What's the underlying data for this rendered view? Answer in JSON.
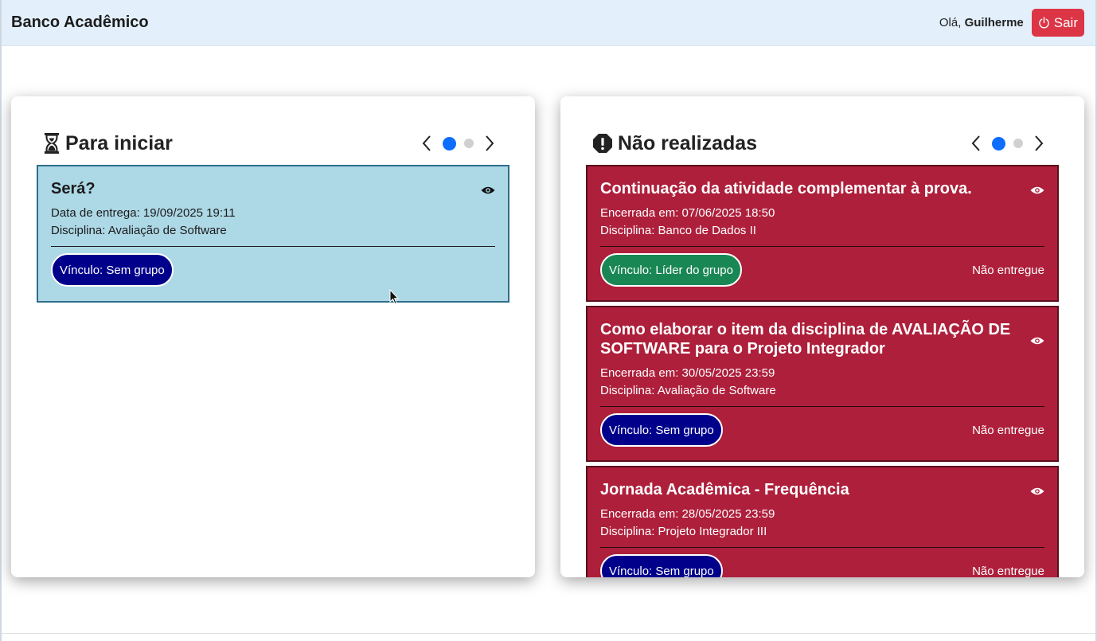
{
  "header": {
    "brand": "Banco Acadêmico",
    "greeting_prefix": "Olá, ",
    "user_name": "Guilherme",
    "logout_label": "Sair"
  },
  "panels": {
    "left": {
      "title": "Para iniciar",
      "icon": "hourglass-icon",
      "pager": {
        "pages": 2,
        "active": 1
      },
      "cards": [
        {
          "title": "Será?",
          "date_line": "Data de entrega: 19/09/2025 19:11",
          "discipline_line": "Disciplina: Avaliação de Software",
          "bond": "Vínculo: Sem grupo"
        }
      ]
    },
    "right": {
      "title": "Não realizadas",
      "icon": "exclamation-octagon-icon",
      "pager": {
        "pages": 2,
        "active": 1
      },
      "cards": [
        {
          "title": "Continuação da atividade complementar à prova.",
          "date_line": "Encerrada em: 07/06/2025 18:50",
          "discipline_line": "Disciplina: Banco de Dados II",
          "bond": "Vínculo: Líder do grupo",
          "status": "Não entregue"
        },
        {
          "title": "Como elaborar o item da disciplina de AVALIAÇÃO DE SOFTWARE para o Projeto Integrador",
          "date_line": "Encerrada em: 30/05/2025 23:59",
          "discipline_line": "Disciplina: Avaliação de Software",
          "bond": "Vínculo: Sem grupo",
          "status": "Não entregue"
        },
        {
          "title": "Jornada Acadêmica - Frequência",
          "date_line": "Encerrada em: 28/05/2025 23:59",
          "discipline_line": "Disciplina: Projeto Integrador III",
          "bond": "Vínculo: Sem grupo",
          "status": "Não entregue"
        }
      ]
    }
  },
  "colors": {
    "topbar": "#e3f0fc",
    "logout": "#dc3545",
    "card_blue": "#add8e6",
    "card_red": "#ae1f3b",
    "pill_navy": "#00008b",
    "pill_green": "#198754",
    "dot_active": "#0d6efd"
  }
}
